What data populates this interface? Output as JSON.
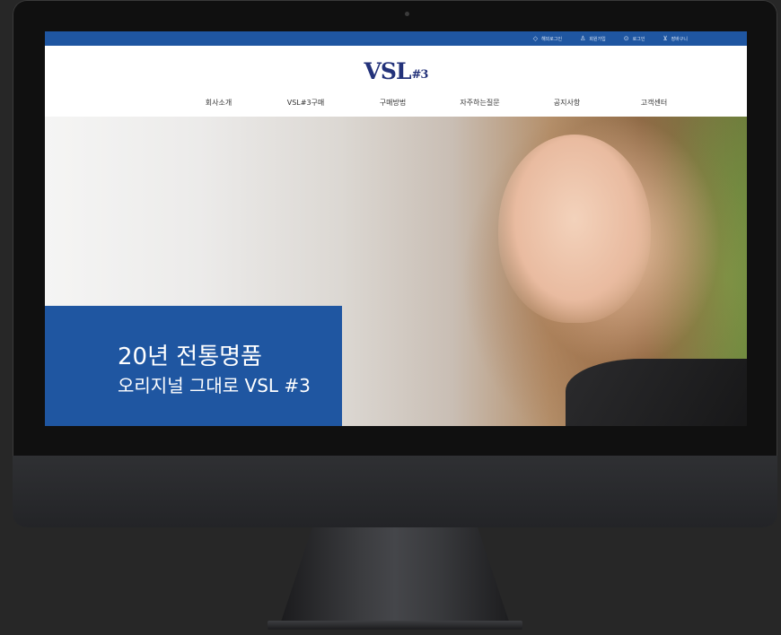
{
  "topbar": {
    "links": [
      {
        "icon": "globe-icon",
        "glyph": "◇",
        "label": "해외로그인"
      },
      {
        "icon": "person-icon",
        "glyph": "♙",
        "label": "회원가입"
      },
      {
        "icon": "lock-icon",
        "glyph": "⊙",
        "label": "로그인"
      },
      {
        "icon": "cart-icon",
        "glyph": "⊻",
        "label": "장바구니"
      }
    ]
  },
  "header": {
    "logo": "VSL",
    "logo_symbol": "#3"
  },
  "nav": {
    "items": [
      "회사소개",
      "VSL#3구매",
      "구매방법",
      "자주하는질문",
      "공지사항",
      "고객센터"
    ]
  },
  "hero": {
    "line1": "20년 전통명품",
    "line2": "오리지널 그대로 VSL #3"
  },
  "colors": {
    "brand_blue": "#1f56a1",
    "logo_navy": "#23327a"
  }
}
